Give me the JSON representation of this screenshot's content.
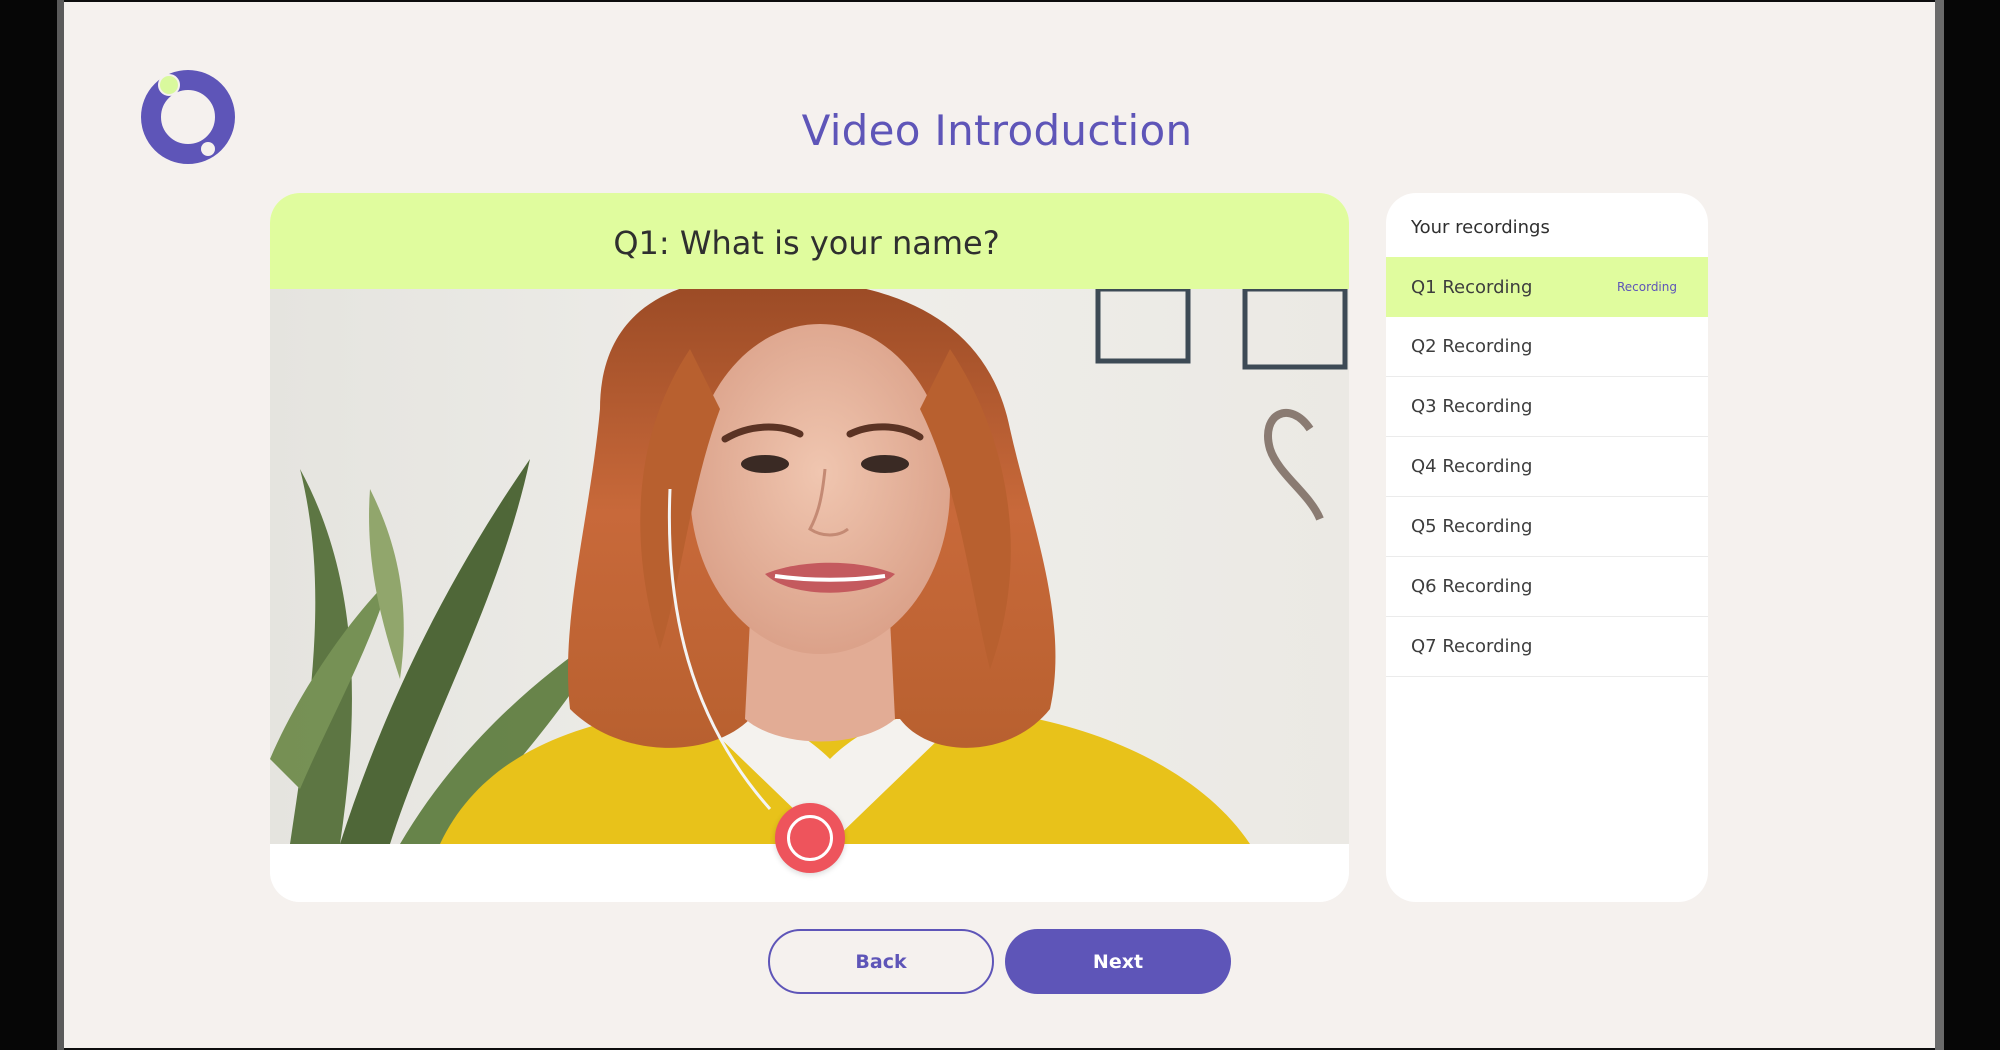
{
  "page": {
    "title": "Video Introduction"
  },
  "logo": {
    "icon": "ring-logo-icon",
    "colors": {
      "ring": "#5e55b8",
      "dot": "#d9f99d"
    }
  },
  "question": {
    "text": "Q1: What is your name?"
  },
  "video": {
    "record_icon": "record-icon",
    "record_color": "#ee545c"
  },
  "recordings": {
    "title": "Your recordings",
    "items": [
      {
        "label": "Q1 Recording",
        "status": "Recording",
        "active": true
      },
      {
        "label": "Q2 Recording",
        "status": "",
        "active": false
      },
      {
        "label": "Q3 Recording",
        "status": "",
        "active": false
      },
      {
        "label": "Q4 Recording",
        "status": "",
        "active": false
      },
      {
        "label": "Q5 Recording",
        "status": "",
        "active": false
      },
      {
        "label": "Q6 Recording",
        "status": "",
        "active": false
      },
      {
        "label": "Q7 Recording",
        "status": "",
        "active": false
      }
    ]
  },
  "navigation": {
    "back_label": "Back",
    "next_label": "Next"
  },
  "colors": {
    "accent": "#5e55b8",
    "highlight": "#e0fc9e",
    "background": "#f5f1ee"
  }
}
